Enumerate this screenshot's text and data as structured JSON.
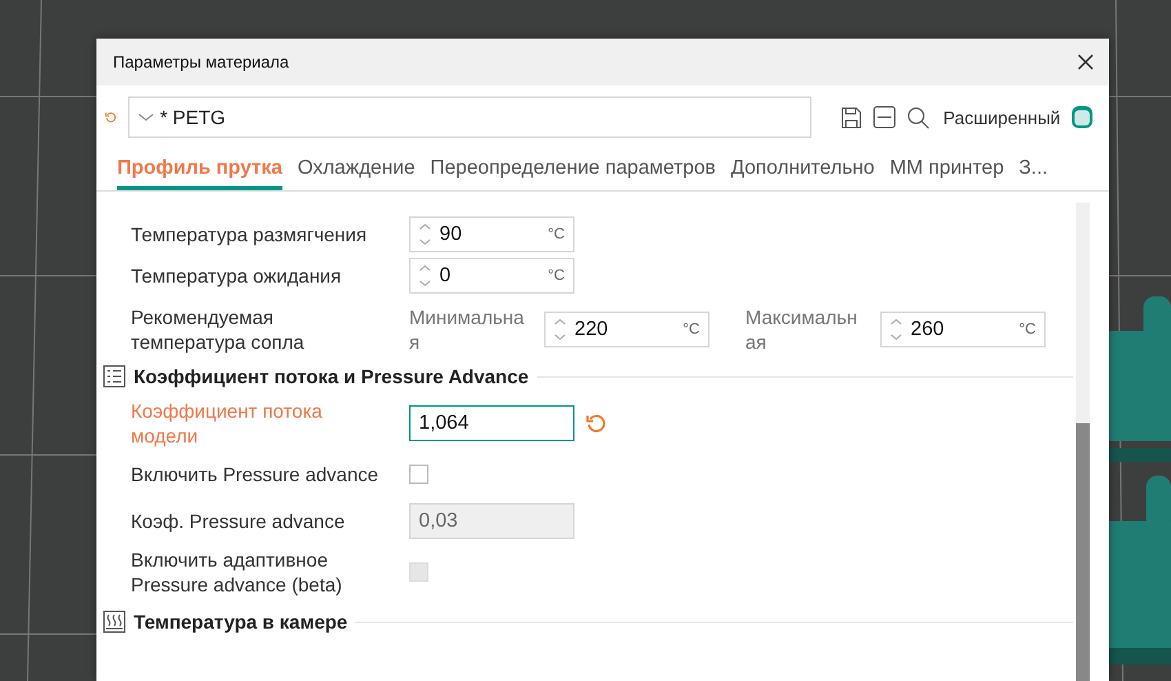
{
  "window": {
    "title": "Параметры материала"
  },
  "toolbar": {
    "preset": "* PETG",
    "advanced_label": "Расширенный",
    "advanced_on": true
  },
  "tabs": [
    {
      "label": "Профиль прутка",
      "selected": true
    },
    {
      "label": "Охлаждение",
      "selected": false
    },
    {
      "label": "Переопределение параметров",
      "selected": false
    },
    {
      "label": "Дополнительно",
      "selected": false
    },
    {
      "label": "MM принтер",
      "selected": false
    },
    {
      "label": "З...",
      "selected": false
    }
  ],
  "rows": [
    {
      "kind": "spin",
      "label": "Температура размягчения",
      "value": "90",
      "unit": "°C"
    },
    {
      "kind": "spin",
      "label": "Температура ожидания",
      "value": "0",
      "unit": "°C"
    },
    {
      "kind": "range",
      "label": "Рекомендуемая температура сопла",
      "min_label": "Минимальная",
      "min_value": "220",
      "min_unit": "°C",
      "max_label": "Максимальная",
      "max_value": "260",
      "max_unit": "°C"
    }
  ],
  "sections": [
    {
      "title": "Коэффициент потока и Pressure Advance",
      "rows": [
        {
          "kind": "text",
          "label": "Коэффициент потока модели",
          "value": "1,064",
          "modified": true,
          "focused": true,
          "disabled": false
        },
        {
          "kind": "checkbox",
          "label": "Включить Pressure advance",
          "checked": false,
          "disabled": false
        },
        {
          "kind": "text",
          "label": "Коэф. Pressure advance",
          "value": "0,03",
          "modified": false,
          "focused": false,
          "disabled": true
        },
        {
          "kind": "checkbox",
          "label": "Включить адаптивное Pressure advance (beta)",
          "checked": false,
          "disabled": true
        }
      ]
    },
    {
      "title": "Температура в камере"
    }
  ]
}
